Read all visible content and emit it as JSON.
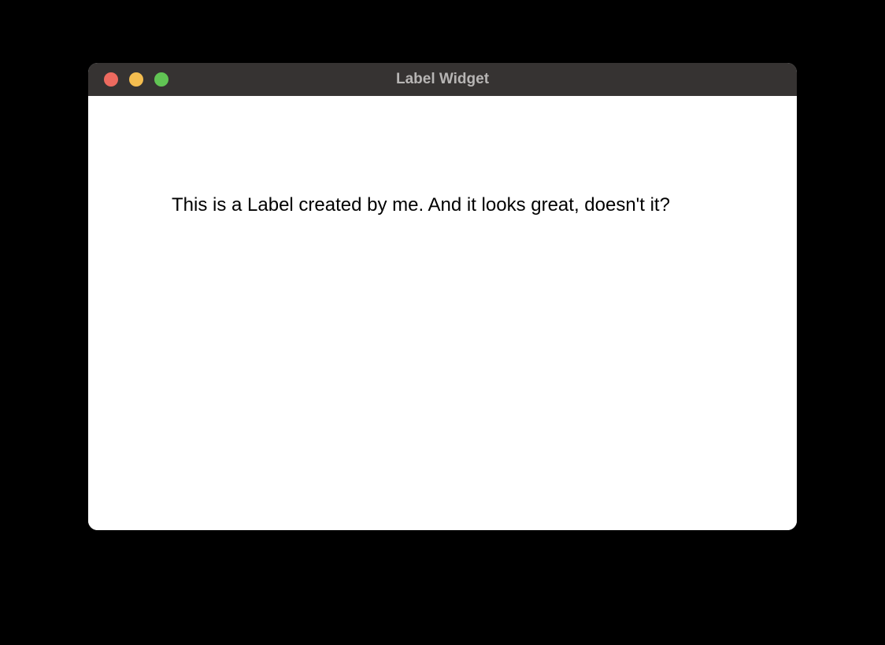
{
  "window": {
    "title": "Label Widget"
  },
  "content": {
    "label_text": "This is a Label created by me. And it looks great, doesn't it?"
  },
  "colors": {
    "titlebar_background": "#363332",
    "title_text": "#b7b5b4",
    "window_background": "#ffffff",
    "body_background": "#000000",
    "traffic_close": "#ed6a5f",
    "traffic_minimize": "#f4bd4f",
    "traffic_maximize": "#61c454"
  }
}
